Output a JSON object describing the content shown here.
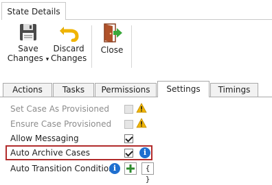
{
  "ribbon": {
    "tab_label": "State Details",
    "buttons": [
      {
        "label1": "Save",
        "label2": "Changes",
        "icon": "floppy-disk-icon",
        "has_dropdown": true
      },
      {
        "label1": "Discard",
        "label2": "Changes",
        "icon": "undo-arrow-icon"
      },
      {
        "label1": "Close",
        "icon": "exit-door-icon"
      }
    ],
    "dropdown_glyph": "▾"
  },
  "tabs": [
    "Actions",
    "Tasks",
    "Permissions",
    "Settings",
    "Timings"
  ],
  "active_tab": "Settings",
  "settings": [
    {
      "label": "Set Case As Provisioned",
      "checked": false,
      "disabled": true,
      "warning": true
    },
    {
      "label": "Ensure Case Provisioned",
      "checked": false,
      "disabled": true,
      "warning": true
    },
    {
      "label": "Allow Messaging",
      "checked": true,
      "disabled": false
    },
    {
      "label": "Auto Archive Cases",
      "checked": true,
      "disabled": false,
      "info": true,
      "highlighted": true
    },
    {
      "label": "Auto Transition Conditions",
      "info": true,
      "add_button": true,
      "braces_button": true
    }
  ],
  "glyphs": {
    "info": "i",
    "warning": "!",
    "braces": "{ }",
    "plus": "+"
  },
  "colors": {
    "highlight": "#b12a2a",
    "info": "#1f6fcf",
    "add": "#2e8b2e",
    "warning": "#f0b400"
  }
}
